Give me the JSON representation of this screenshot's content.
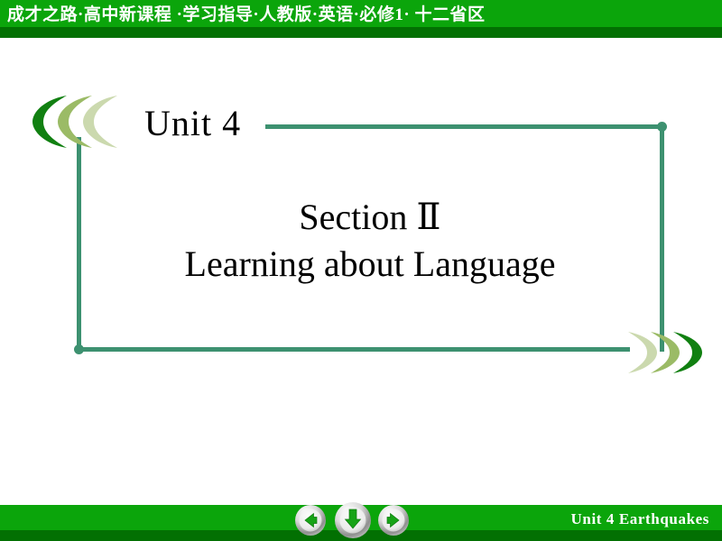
{
  "header": {
    "text": "成才之路·高中新课程 ·学习指导·人教版·英语·必修1· 十二省区",
    "bg_color": "#0ba50b",
    "shadow_color": "#027002",
    "text_color": "#ffffff"
  },
  "title": {
    "unit": "Unit 4",
    "section_line1": "Section  Ⅱ",
    "section_line2": "Learning about Language"
  },
  "decor": {
    "frame_color": "#3d9170",
    "crescent_dark": "#118011",
    "crescent_mid": "#9bbb66",
    "crescent_light": "#cbd9ae"
  },
  "footer": {
    "text": "Unit  4   Earthquakes",
    "bg_color": "#0ba50b",
    "shadow_color": "#027002",
    "text_color": "#ffffff"
  },
  "nav": {
    "prev_label": "previous-slide",
    "down_label": "next-step",
    "next_label": "next-slide",
    "arrow_color": "#17a317"
  }
}
